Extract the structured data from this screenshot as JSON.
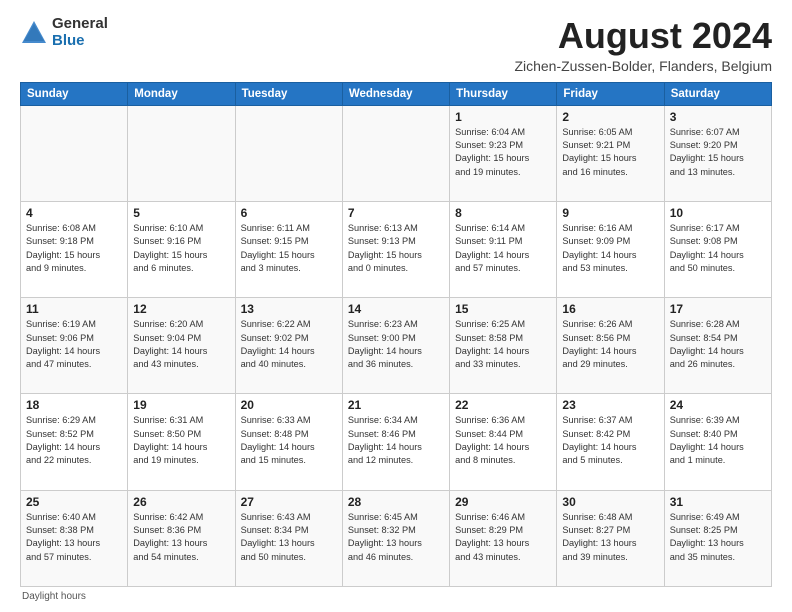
{
  "header": {
    "logo_general": "General",
    "logo_blue": "Blue",
    "month_title": "August 2024",
    "location": "Zichen-Zussen-Bolder, Flanders, Belgium"
  },
  "footer": {
    "note": "Daylight hours"
  },
  "days_of_week": [
    "Sunday",
    "Monday",
    "Tuesday",
    "Wednesday",
    "Thursday",
    "Friday",
    "Saturday"
  ],
  "weeks": [
    [
      {
        "day": "",
        "info": ""
      },
      {
        "day": "",
        "info": ""
      },
      {
        "day": "",
        "info": ""
      },
      {
        "day": "",
        "info": ""
      },
      {
        "day": "1",
        "info": "Sunrise: 6:04 AM\nSunset: 9:23 PM\nDaylight: 15 hours\nand 19 minutes."
      },
      {
        "day": "2",
        "info": "Sunrise: 6:05 AM\nSunset: 9:21 PM\nDaylight: 15 hours\nand 16 minutes."
      },
      {
        "day": "3",
        "info": "Sunrise: 6:07 AM\nSunset: 9:20 PM\nDaylight: 15 hours\nand 13 minutes."
      }
    ],
    [
      {
        "day": "4",
        "info": "Sunrise: 6:08 AM\nSunset: 9:18 PM\nDaylight: 15 hours\nand 9 minutes."
      },
      {
        "day": "5",
        "info": "Sunrise: 6:10 AM\nSunset: 9:16 PM\nDaylight: 15 hours\nand 6 minutes."
      },
      {
        "day": "6",
        "info": "Sunrise: 6:11 AM\nSunset: 9:15 PM\nDaylight: 15 hours\nand 3 minutes."
      },
      {
        "day": "7",
        "info": "Sunrise: 6:13 AM\nSunset: 9:13 PM\nDaylight: 15 hours\nand 0 minutes."
      },
      {
        "day": "8",
        "info": "Sunrise: 6:14 AM\nSunset: 9:11 PM\nDaylight: 14 hours\nand 57 minutes."
      },
      {
        "day": "9",
        "info": "Sunrise: 6:16 AM\nSunset: 9:09 PM\nDaylight: 14 hours\nand 53 minutes."
      },
      {
        "day": "10",
        "info": "Sunrise: 6:17 AM\nSunset: 9:08 PM\nDaylight: 14 hours\nand 50 minutes."
      }
    ],
    [
      {
        "day": "11",
        "info": "Sunrise: 6:19 AM\nSunset: 9:06 PM\nDaylight: 14 hours\nand 47 minutes."
      },
      {
        "day": "12",
        "info": "Sunrise: 6:20 AM\nSunset: 9:04 PM\nDaylight: 14 hours\nand 43 minutes."
      },
      {
        "day": "13",
        "info": "Sunrise: 6:22 AM\nSunset: 9:02 PM\nDaylight: 14 hours\nand 40 minutes."
      },
      {
        "day": "14",
        "info": "Sunrise: 6:23 AM\nSunset: 9:00 PM\nDaylight: 14 hours\nand 36 minutes."
      },
      {
        "day": "15",
        "info": "Sunrise: 6:25 AM\nSunset: 8:58 PM\nDaylight: 14 hours\nand 33 minutes."
      },
      {
        "day": "16",
        "info": "Sunrise: 6:26 AM\nSunset: 8:56 PM\nDaylight: 14 hours\nand 29 minutes."
      },
      {
        "day": "17",
        "info": "Sunrise: 6:28 AM\nSunset: 8:54 PM\nDaylight: 14 hours\nand 26 minutes."
      }
    ],
    [
      {
        "day": "18",
        "info": "Sunrise: 6:29 AM\nSunset: 8:52 PM\nDaylight: 14 hours\nand 22 minutes."
      },
      {
        "day": "19",
        "info": "Sunrise: 6:31 AM\nSunset: 8:50 PM\nDaylight: 14 hours\nand 19 minutes."
      },
      {
        "day": "20",
        "info": "Sunrise: 6:33 AM\nSunset: 8:48 PM\nDaylight: 14 hours\nand 15 minutes."
      },
      {
        "day": "21",
        "info": "Sunrise: 6:34 AM\nSunset: 8:46 PM\nDaylight: 14 hours\nand 12 minutes."
      },
      {
        "day": "22",
        "info": "Sunrise: 6:36 AM\nSunset: 8:44 PM\nDaylight: 14 hours\nand 8 minutes."
      },
      {
        "day": "23",
        "info": "Sunrise: 6:37 AM\nSunset: 8:42 PM\nDaylight: 14 hours\nand 5 minutes."
      },
      {
        "day": "24",
        "info": "Sunrise: 6:39 AM\nSunset: 8:40 PM\nDaylight: 14 hours\nand 1 minute."
      }
    ],
    [
      {
        "day": "25",
        "info": "Sunrise: 6:40 AM\nSunset: 8:38 PM\nDaylight: 13 hours\nand 57 minutes."
      },
      {
        "day": "26",
        "info": "Sunrise: 6:42 AM\nSunset: 8:36 PM\nDaylight: 13 hours\nand 54 minutes."
      },
      {
        "day": "27",
        "info": "Sunrise: 6:43 AM\nSunset: 8:34 PM\nDaylight: 13 hours\nand 50 minutes."
      },
      {
        "day": "28",
        "info": "Sunrise: 6:45 AM\nSunset: 8:32 PM\nDaylight: 13 hours\nand 46 minutes."
      },
      {
        "day": "29",
        "info": "Sunrise: 6:46 AM\nSunset: 8:29 PM\nDaylight: 13 hours\nand 43 minutes."
      },
      {
        "day": "30",
        "info": "Sunrise: 6:48 AM\nSunset: 8:27 PM\nDaylight: 13 hours\nand 39 minutes."
      },
      {
        "day": "31",
        "info": "Sunrise: 6:49 AM\nSunset: 8:25 PM\nDaylight: 13 hours\nand 35 minutes."
      }
    ]
  ]
}
